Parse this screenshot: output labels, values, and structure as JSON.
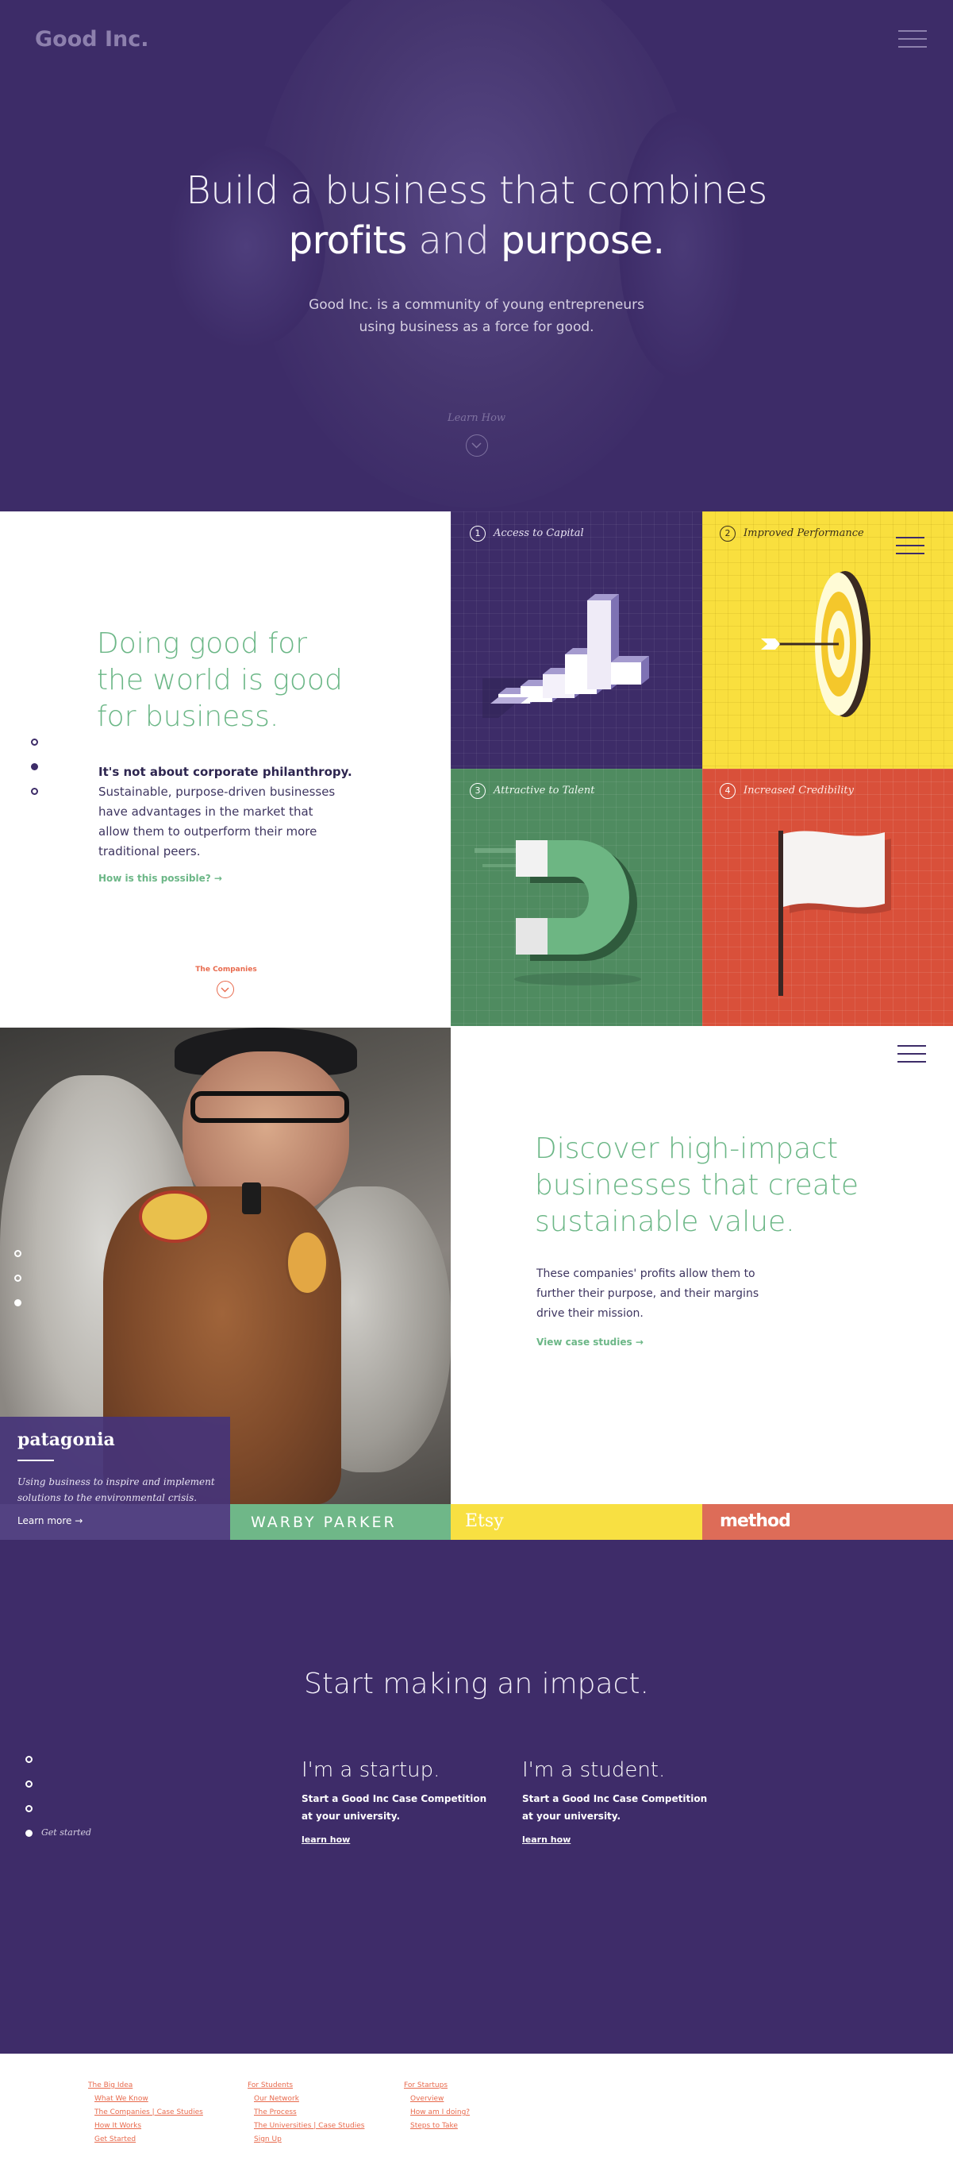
{
  "hero": {
    "logo": "Good Inc.",
    "headline_line1": "Build a business that combines",
    "headline_word1": "profits",
    "headline_and": "and",
    "headline_word2": "purpose.",
    "subtitle_line1": "Good Inc. is a community of young entrepreneurs",
    "subtitle_line2": "using business as a force for good.",
    "cta": "Learn How"
  },
  "benefits": {
    "heading_line1": "Doing good for",
    "heading_line2": "the world is good",
    "heading_line3": "for business.",
    "bold_lead": "It's not about corporate philanthropy.",
    "body_line1": "Sustainable, purpose-driven businesses",
    "body_line2": "have advantages in the market that",
    "body_line3": "allow them to outperform their more",
    "body_line4": "traditional peers.",
    "link": "How is this possible? →",
    "next_section": "The Companies",
    "tiles": [
      {
        "num": "1",
        "label": "Access to Capital",
        "color": "#3d2c68"
      },
      {
        "num": "2",
        "label": "Improved Performance",
        "color": "#f9df3e"
      },
      {
        "num": "3",
        "label": "Attractive to Talent",
        "color": "#4f8b60"
      },
      {
        "num": "4",
        "label": "Increased Credibility",
        "color": "#d9503a"
      }
    ]
  },
  "companies": {
    "heading_line1": "Discover high-impact",
    "heading_line2": "businesses that create",
    "heading_line3": "sustainable value.",
    "body_line1": "These companies' profits allow them to",
    "body_line2": "further their purpose, and their margins",
    "body_line3": "drive their mission.",
    "link": "View case studies →",
    "featured": {
      "name": "patagonia",
      "desc_line1": "Using business to inspire and implement",
      "desc_line2": "solutions to the environmental crisis.",
      "link": "Learn more →"
    },
    "tabs": [
      {
        "name": "WARBY PARKER",
        "color": "#6fb788"
      },
      {
        "name": "Etsy",
        "color": "#f8e042"
      },
      {
        "name": "method",
        "color": "#dd6c58"
      }
    ]
  },
  "impact": {
    "heading": "Start making an impact.",
    "get_started": "Get started",
    "startup": {
      "title": "I'm a startup.",
      "line1": "Start a Good Inc Case Competition",
      "line2": "at your university.",
      "link": "learn how"
    },
    "student": {
      "title": "I'm a student.",
      "line1": "Start a Good Inc Case Competition",
      "line2": "at your university.",
      "link": "learn how"
    }
  },
  "footer": {
    "col1": {
      "title": "The Big Idea",
      "items": [
        "What We Know",
        "The Companies  |  Case Studies",
        "How It Works",
        "Get Started"
      ]
    },
    "col2": {
      "title": "For Students",
      "items": [
        "Our Network",
        "The Process",
        "The Universities  |  Case Studies",
        "Sign Up"
      ]
    },
    "col3": {
      "title": "For Startups",
      "items": [
        "Overview",
        "How am I doing?",
        "Steps to Take"
      ]
    }
  },
  "colors": {
    "purple": "#3d2c68",
    "green": "#6cb787",
    "yellow": "#f9df3e",
    "red": "#d9503a",
    "orange_link": "#e86a4d"
  }
}
